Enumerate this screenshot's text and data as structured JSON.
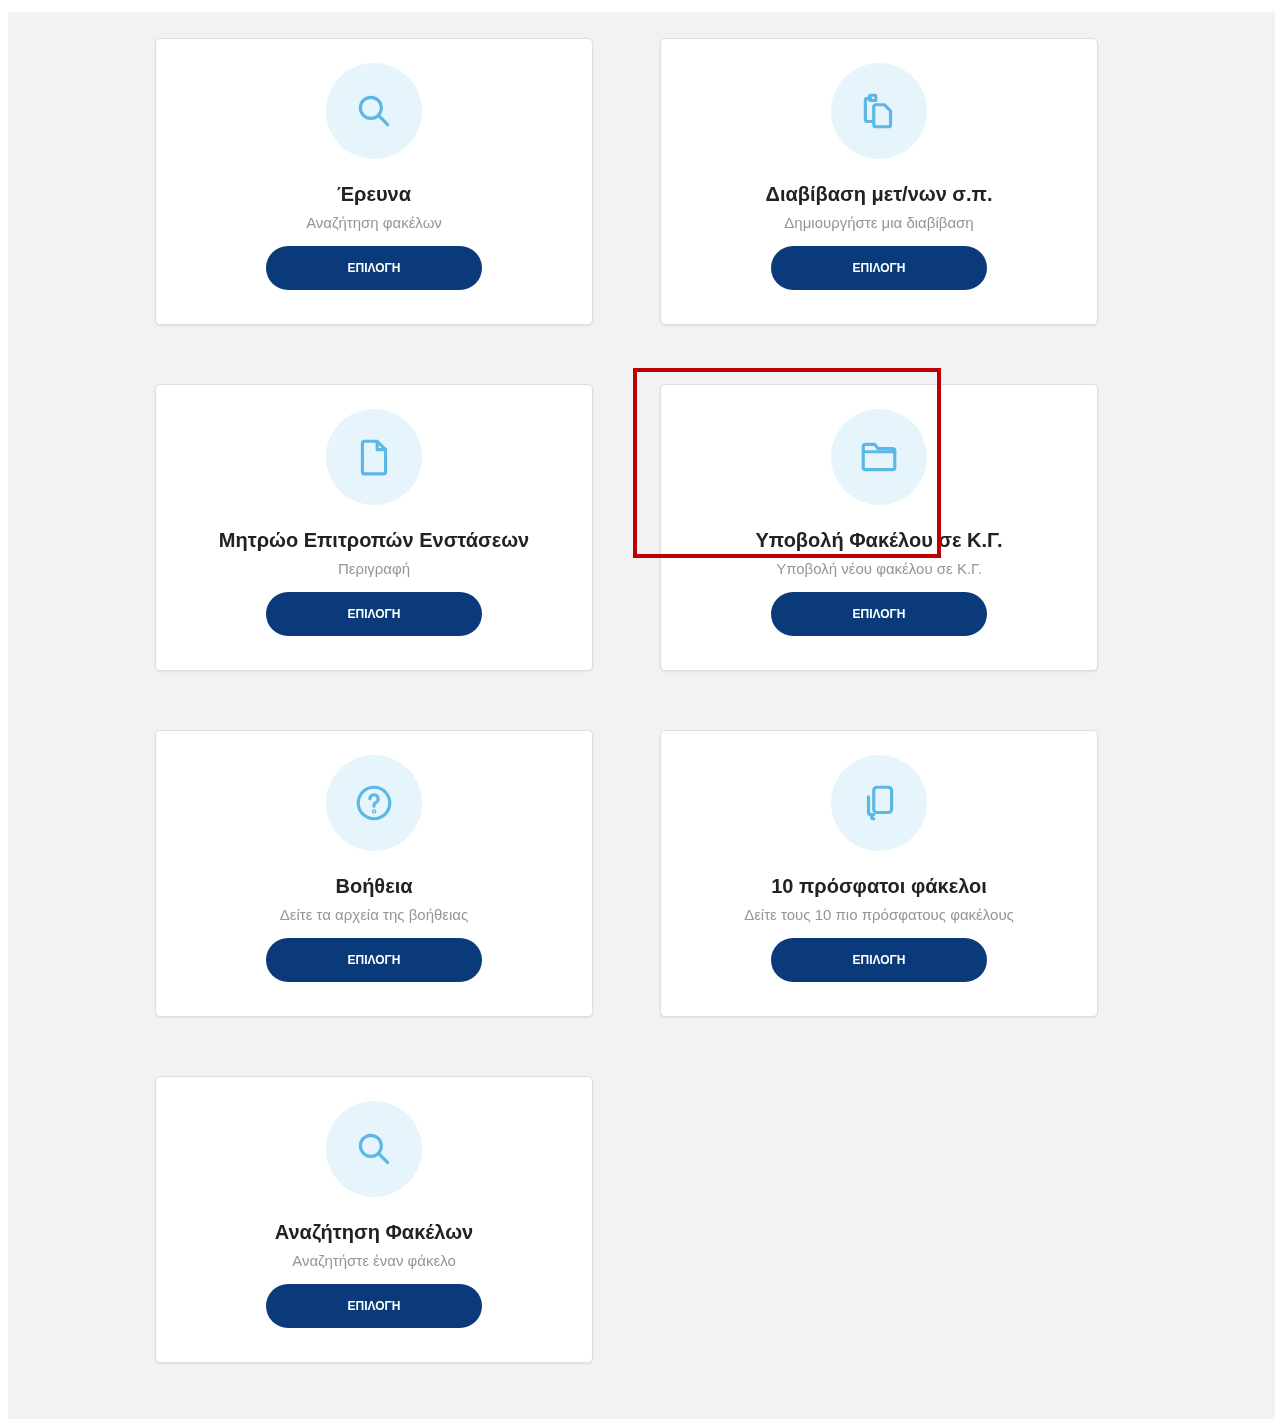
{
  "cards": [
    {
      "kind": "search",
      "title": "Έρευνα",
      "subtitle": "Αναζήτηση φακέλων",
      "button": "ΕΠΙΛΟΓΗ",
      "highlighted": false
    },
    {
      "kind": "clipboard",
      "title": "Διαβίβαση μετ/νων σ.π.",
      "subtitle": "Δημιουργήστε μια διαβίβαση",
      "button": "ΕΠΙΛΟΓΗ",
      "highlighted": false
    },
    {
      "kind": "file",
      "title": "Μητρώο Επιτροπών Ενστάσεων",
      "subtitle": "Περιγραφή",
      "button": "ΕΠΙΛΟΓΗ",
      "highlighted": false
    },
    {
      "kind": "folder",
      "title": "Υποβολή Φακέλου σε Κ.Γ.",
      "subtitle": "Υποβολή νέου φακέλου σε Κ.Γ.",
      "button": "ΕΠΙΛΟΓΗ",
      "highlighted": true
    },
    {
      "kind": "help",
      "title": "Βοήθεια",
      "subtitle": "Δείτε τα αρχεία της βοήθειας",
      "button": "ΕΠΙΛΟΓΗ",
      "highlighted": false
    },
    {
      "kind": "copy",
      "title": "10 πρόσφατοι φάκελοι",
      "subtitle": "Δείτε τους 10 πιο πρόσφατους φακέλους",
      "button": "ΕΠΙΛΟΓΗ",
      "highlighted": false
    },
    {
      "kind": "search",
      "title": "Αναζήτηση Φακέλων",
      "subtitle": "Αναζητήστε έναν φάκελο",
      "button": "ΕΠΙΛΟΓΗ",
      "highlighted": false
    }
  ]
}
